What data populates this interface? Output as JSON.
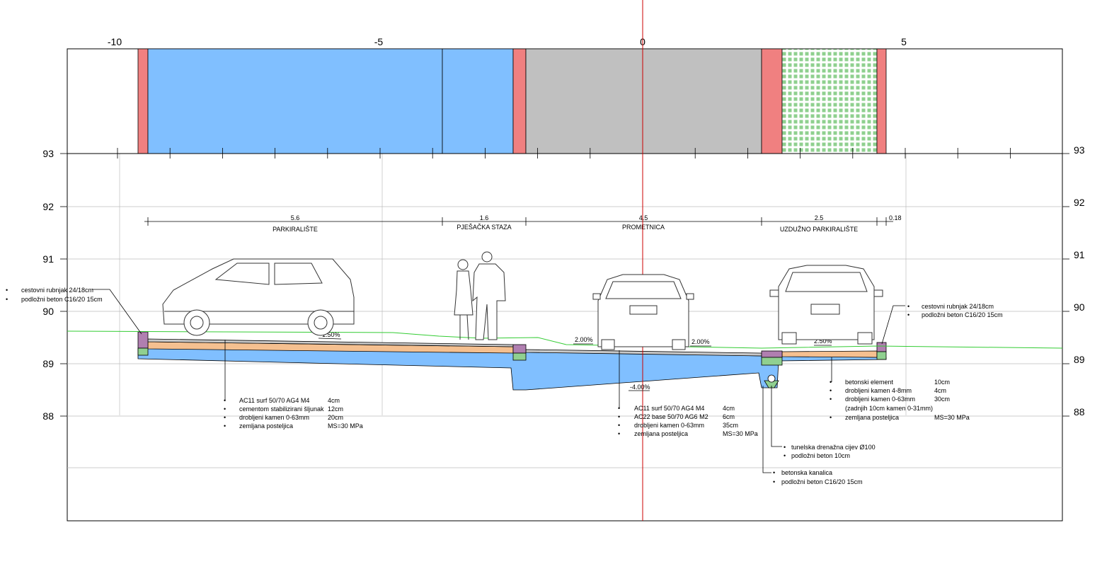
{
  "x_ticks": [
    "-10",
    "-5",
    "0",
    "5"
  ],
  "y_ticks": [
    "93",
    "92",
    "91",
    "90",
    "89",
    "88"
  ],
  "zones": [
    {
      "width": "5.6",
      "name": "PARKIRALIŠTE"
    },
    {
      "width": "1.6",
      "name": "PJEŠAČKA STAZA"
    },
    {
      "width": "4.5",
      "name": "PROMETNICA"
    },
    {
      "width": "2.5",
      "name": "UZDUŽNO PARKIRALIŠTE"
    },
    {
      "width": "0.18",
      "name": ""
    }
  ],
  "slopes": [
    "1.50%",
    "2.00%",
    "2.00%",
    "-4.00%",
    "2.50%"
  ],
  "left_curb": {
    "line1": "cestovni rubnjak 24/18cm",
    "line2": "podložni beton C16/20 15cm"
  },
  "right_curb": {
    "line1": "cestovni rubnjak 24/18cm",
    "line2": "podložni beton C16/20 15cm"
  },
  "layers_parking": [
    {
      "name": "AC11 surf 50/70 AG4 M4",
      "value": "4cm"
    },
    {
      "name": "cementom stabilizirani šljunak",
      "value": "12cm"
    },
    {
      "name": "drobljeni kamen 0-63mm",
      "value": "20cm"
    },
    {
      "name": "zemljana posteljica",
      "value": "MS=30 MPa"
    }
  ],
  "layers_road": [
    {
      "name": "AC11 surf 50/70 AG4 M4",
      "value": "4cm"
    },
    {
      "name": "AC22 base 50/70 AG6 M2",
      "value": "6cm"
    },
    {
      "name": "drobljeni kamen 0-63mm",
      "value": "35cm"
    },
    {
      "name": "zemljana posteljica",
      "value": "MS=30 MPa"
    }
  ],
  "layers_long_parking": [
    {
      "name": "betonski element",
      "value": "10cm"
    },
    {
      "name": "drobljeni kamen 4-8mm",
      "value": "4cm"
    },
    {
      "name": "drobljeni kamen 0-63mm",
      "value": "30cm"
    },
    {
      "name": "(zadnjih 10cm kamen 0-31mm)",
      "value": ""
    },
    {
      "name": "zemljana posteljica",
      "value": "MS=30 MPa"
    }
  ],
  "drain": {
    "line1": "tunelska drenažna cijev Ø100",
    "line2": "podložni beton 10cm"
  },
  "channel": {
    "line1": "betonska kanalica",
    "line2": "podložni beton C16/20 15cm"
  },
  "colors": {
    "parking_blue": "#80bfff",
    "road_gray": "#c0c0c0",
    "curb_red": "#f08080",
    "grass_green": "#90d090",
    "gravel_orange": "#f5c090",
    "curb_purple": "#b07fb0",
    "terrain_green": "#33cc33",
    "axis_red": "#cc0000"
  }
}
